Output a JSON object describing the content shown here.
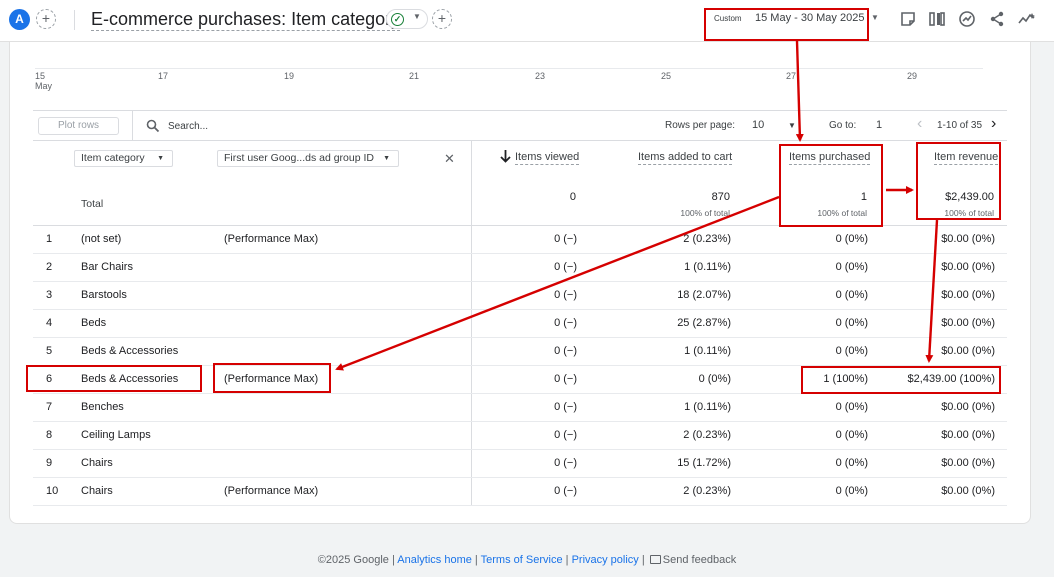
{
  "header": {
    "avatar_letter": "A",
    "title": "E-commerce purchases: Item category",
    "add_icon": "plus-icon",
    "status_icon": "check-circle-icon",
    "date_custom_label": "Custom",
    "date_range": "15 May - 30 May 2025",
    "tools": [
      "notes-icon",
      "compare-icon",
      "insights-icon",
      "share-icon",
      "trend-icon"
    ]
  },
  "chart": {
    "x_ticks": [
      {
        "label": "15",
        "sub": "May"
      },
      {
        "label": "17",
        "sub": ""
      },
      {
        "label": "19",
        "sub": ""
      },
      {
        "label": "21",
        "sub": ""
      },
      {
        "label": "23",
        "sub": ""
      },
      {
        "label": "25",
        "sub": ""
      },
      {
        "label": "27",
        "sub": ""
      },
      {
        "label": "29",
        "sub": ""
      }
    ]
  },
  "toolbar": {
    "plot_rows": "Plot rows",
    "search_placeholder": "Search...",
    "rows_per_page_label": "Rows per page:",
    "rows_per_page_value": "10",
    "goto_label": "Go to:",
    "goto_value": "1",
    "page_range": "1-10 of 35"
  },
  "table": {
    "dim1": "Item category",
    "dim2": "First user Goog...ds ad group ID",
    "metrics": [
      "Items viewed",
      "Items added to cart",
      "Items purchased",
      "Item revenue"
    ],
    "total_label": "Total",
    "totals": [
      "0",
      "870",
      "1",
      "$2,439.00"
    ],
    "totals_sub": [
      "",
      "100% of total",
      "100% of total",
      "100% of total"
    ],
    "rows": [
      {
        "n": "1",
        "cat": "(not set)",
        "group": "(Performance Max)",
        "viewed": "0 (−)",
        "added": "2 (0.23%)",
        "purchased": "0 (0%)",
        "revenue": "$0.00 (0%)"
      },
      {
        "n": "2",
        "cat": "Bar Chairs",
        "group": "",
        "viewed": "0 (−)",
        "added": "1 (0.11%)",
        "purchased": "0 (0%)",
        "revenue": "$0.00 (0%)"
      },
      {
        "n": "3",
        "cat": "Barstools",
        "group": "",
        "viewed": "0 (−)",
        "added": "18 (2.07%)",
        "purchased": "0 (0%)",
        "revenue": "$0.00 (0%)"
      },
      {
        "n": "4",
        "cat": "Beds",
        "group": "",
        "viewed": "0 (−)",
        "added": "25 (2.87%)",
        "purchased": "0 (0%)",
        "revenue": "$0.00 (0%)"
      },
      {
        "n": "5",
        "cat": "Beds & Accessories",
        "group": "",
        "viewed": "0 (−)",
        "added": "1 (0.11%)",
        "purchased": "0 (0%)",
        "revenue": "$0.00 (0%)"
      },
      {
        "n": "6",
        "cat": "Beds & Accessories",
        "group": "(Performance Max)",
        "viewed": "0 (−)",
        "added": "0 (0%)",
        "purchased": "1 (100%)",
        "revenue": "$2,439.00 (100%)"
      },
      {
        "n": "7",
        "cat": "Benches",
        "group": "",
        "viewed": "0 (−)",
        "added": "1 (0.11%)",
        "purchased": "0 (0%)",
        "revenue": "$0.00 (0%)"
      },
      {
        "n": "8",
        "cat": "Ceiling Lamps",
        "group": "",
        "viewed": "0 (−)",
        "added": "2 (0.23%)",
        "purchased": "0 (0%)",
        "revenue": "$0.00 (0%)"
      },
      {
        "n": "9",
        "cat": "Chairs",
        "group": "",
        "viewed": "0 (−)",
        "added": "15 (1.72%)",
        "purchased": "0 (0%)",
        "revenue": "$0.00 (0%)"
      },
      {
        "n": "10",
        "cat": "Chairs",
        "group": "(Performance Max)",
        "viewed": "0 (−)",
        "added": "2 (0.23%)",
        "purchased": "0 (0%)",
        "revenue": "$0.00 (0%)"
      }
    ]
  },
  "footer": {
    "copyright": "©2025 Google |",
    "links": [
      "Analytics home",
      "Terms of Service",
      "Privacy policy"
    ],
    "feedback": "Send feedback"
  },
  "annotation_color": "#d50000"
}
